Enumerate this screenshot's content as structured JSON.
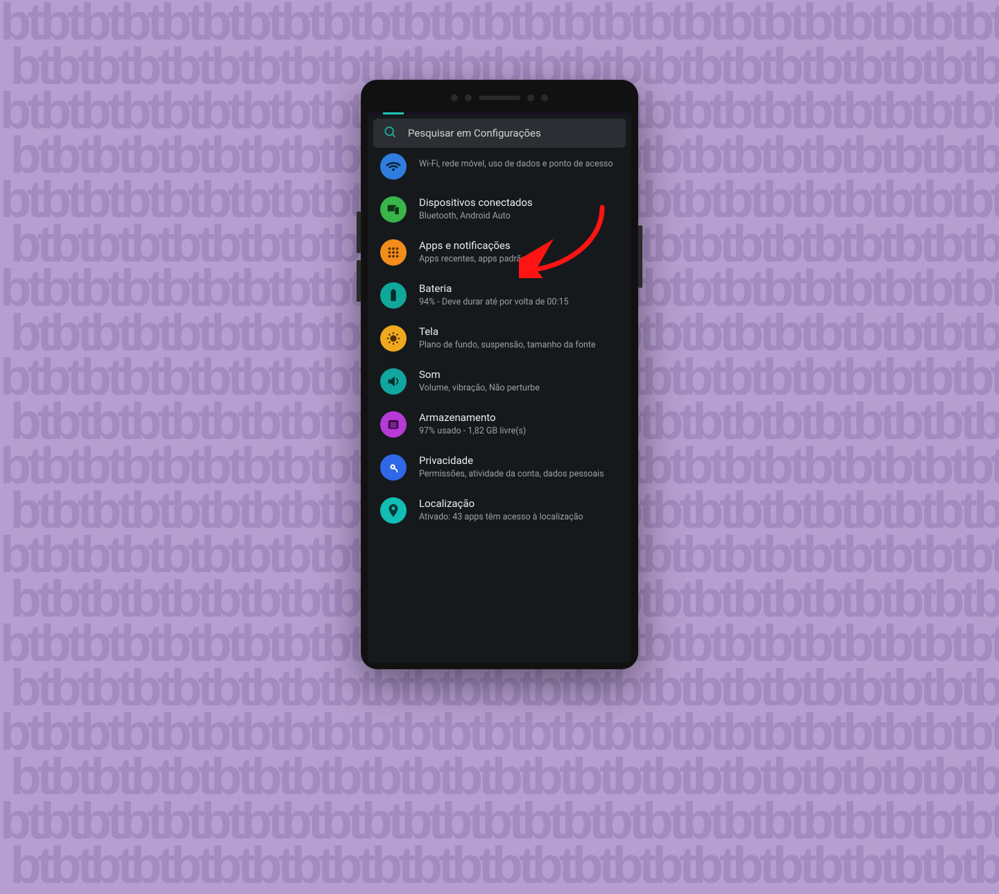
{
  "search": {
    "placeholder": "Pesquisar em Configurações"
  },
  "items": [
    {
      "icon": "wifi-icon",
      "color": "c-blue",
      "title": "",
      "subtitle": "Wi-Fi, rede móvel, uso de dados e ponto de acesso"
    },
    {
      "icon": "devices-icon",
      "color": "c-green",
      "title": "Dispositivos conectados",
      "subtitle": "Bluetooth, Android Auto"
    },
    {
      "icon": "apps-icon",
      "color": "c-orange",
      "title": "Apps e notificações",
      "subtitle": "Apps recentes, apps padrão"
    },
    {
      "icon": "battery-icon",
      "color": "c-teal",
      "title": "Bateria",
      "subtitle": "94% - Deve durar até por volta de 00:15"
    },
    {
      "icon": "display-icon",
      "color": "c-yellow",
      "title": "Tela",
      "subtitle": "Plano de fundo, suspensão, tamanho da fonte"
    },
    {
      "icon": "sound-icon",
      "color": "c-cyan",
      "title": "Som",
      "subtitle": "Volume, vibração, Não perturbe"
    },
    {
      "icon": "storage-icon",
      "color": "c-magenta",
      "title": "Armazenamento",
      "subtitle": "97% usado - 1,82 GB livre(s)"
    },
    {
      "icon": "privacy-icon",
      "color": "c-blue2",
      "title": "Privacidade",
      "subtitle": "Permissões, atividade da conta, dados pessoais"
    },
    {
      "icon": "location-icon",
      "color": "c-cyan2",
      "title": "Localização",
      "subtitle": "Ativado: 43 apps têm acesso à localização"
    }
  ],
  "annotation": {
    "target_index": 2,
    "arrow_color": "#ff1414"
  }
}
